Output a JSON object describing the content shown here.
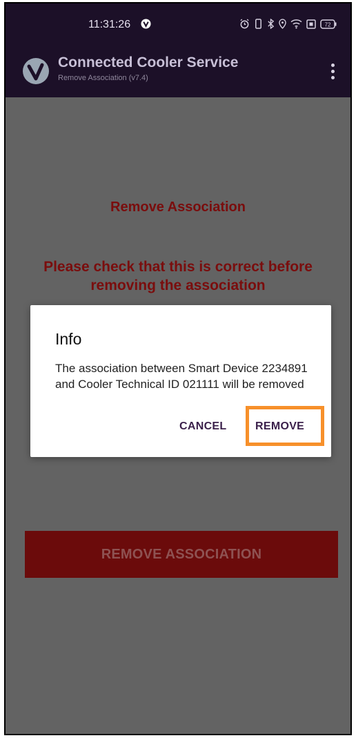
{
  "status_bar": {
    "time": "11:31:26",
    "battery": "72"
  },
  "app_bar": {
    "title": "Connected Cooler Service",
    "subtitle": "Remove Association (v7.4)"
  },
  "content": {
    "title": "Remove Association",
    "warning": "Please check that this is correct before removing the association",
    "primary_button": "REMOVE ASSOCIATION"
  },
  "dialog": {
    "title": "Info",
    "message": "The association between Smart Device 2234891 and Cooler Technical ID 021111 will be removed",
    "cancel_label": "CANCEL",
    "remove_label": "REMOVE"
  },
  "colors": {
    "highlight": "#f7902a",
    "accent_red": "#7a0d0d",
    "app_bar": "#1c1028"
  }
}
